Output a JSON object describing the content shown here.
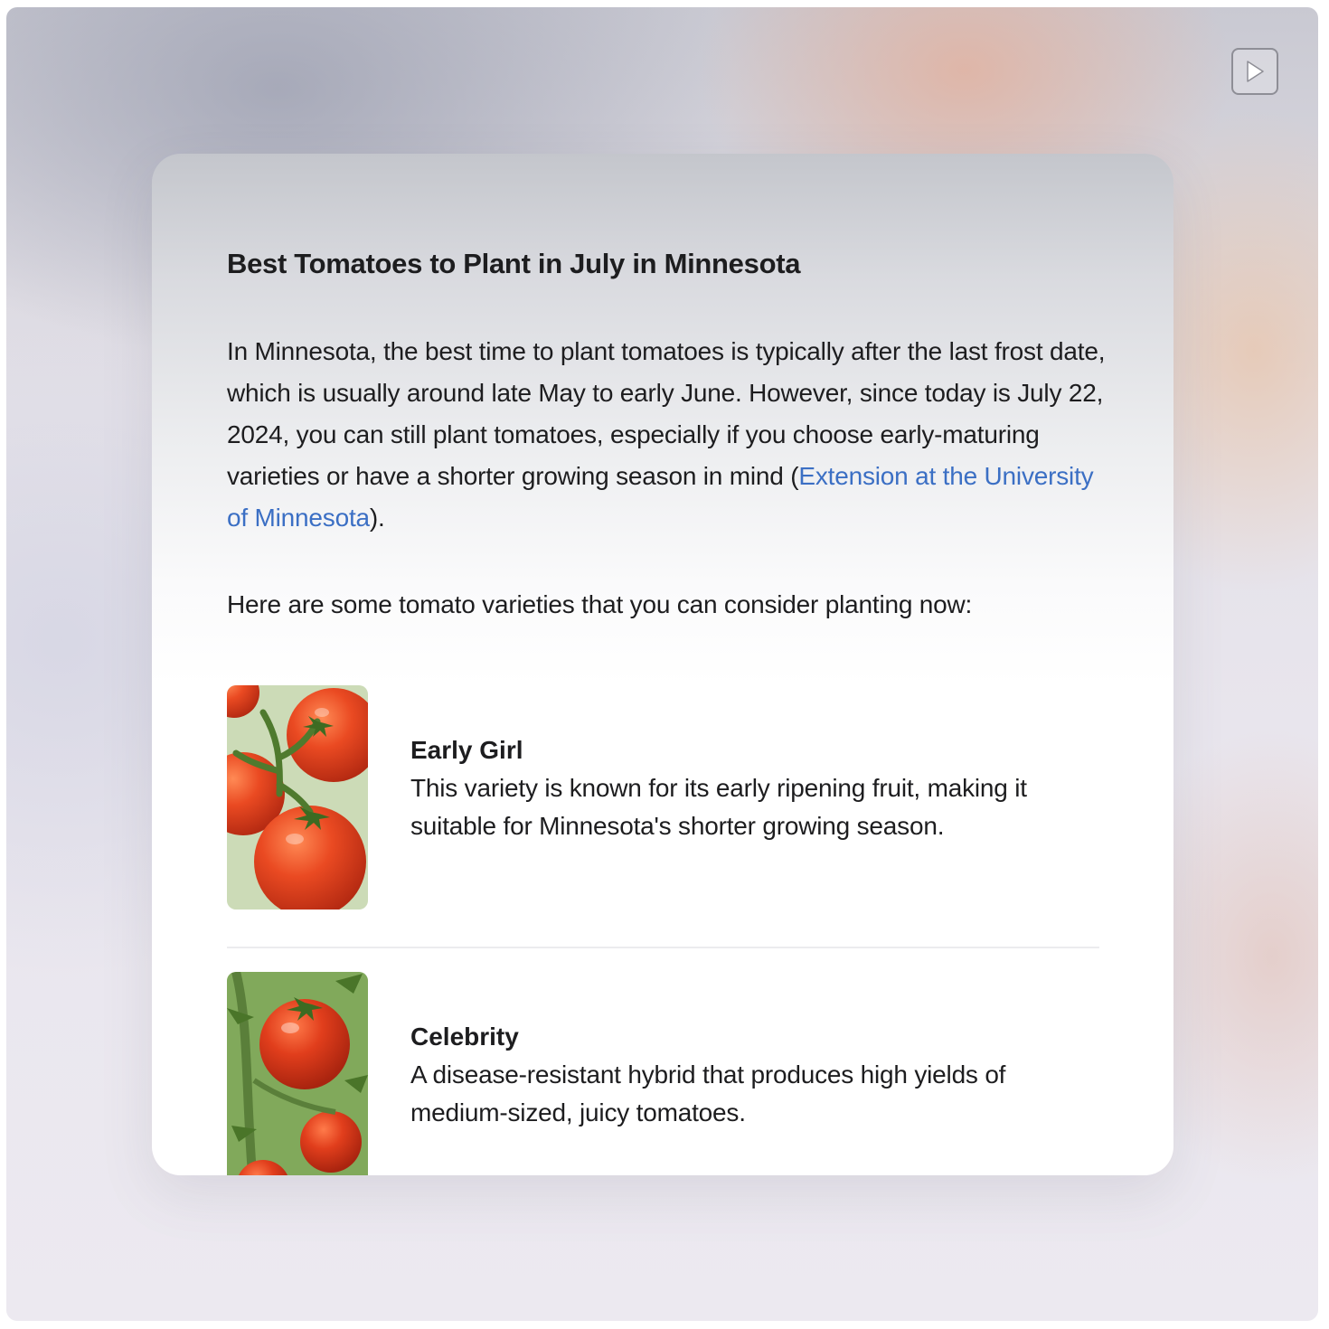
{
  "card": {
    "title": "Best Tomatoes to Plant in July in Minnesota",
    "intro_before_link": "In Minnesota, the best time to plant tomatoes is typically after the last frost date, which is usually around late May to early June. However, since today is July 22, 2024, you can still plant tomatoes, especially if you choose early-maturing varieties or have a shorter growing season in mind (",
    "intro_link": "Extension at the University of Minnesota",
    "intro_after_link": ").",
    "lead": "Here are some tomato varieties that you can consider planting now:",
    "varieties": [
      {
        "name": "Early Girl",
        "description": "This variety is known for its early ripening fruit, making it suitable for Minnesota's shorter growing season."
      },
      {
        "name": "Celebrity",
        "description": "A disease-resistant hybrid that produces high yields of medium-sized, juicy tomatoes."
      }
    ]
  },
  "controls": {
    "play_icon": "play-icon"
  },
  "colors": {
    "link": "#3b6fc4",
    "text": "#1d1d1f",
    "tomato": "#e8462a",
    "vine": "#4f7a2e"
  }
}
